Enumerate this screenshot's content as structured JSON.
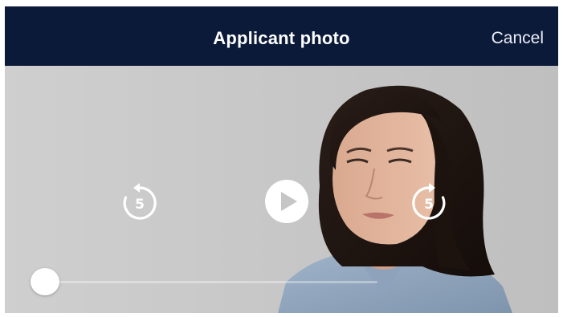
{
  "header": {
    "title": "Applicant photo",
    "cancel_label": "Cancel"
  },
  "player": {
    "rewind_seconds": "5",
    "forward_seconds": "5",
    "play_icon": "play-icon",
    "rewind_icon": "rewind-5-icon",
    "forward_icon": "forward-5-icon",
    "progress": 0.0
  },
  "colors": {
    "header_bg": "#0c1a3a",
    "header_text": "#ffffff",
    "controls": "#ffffff"
  }
}
